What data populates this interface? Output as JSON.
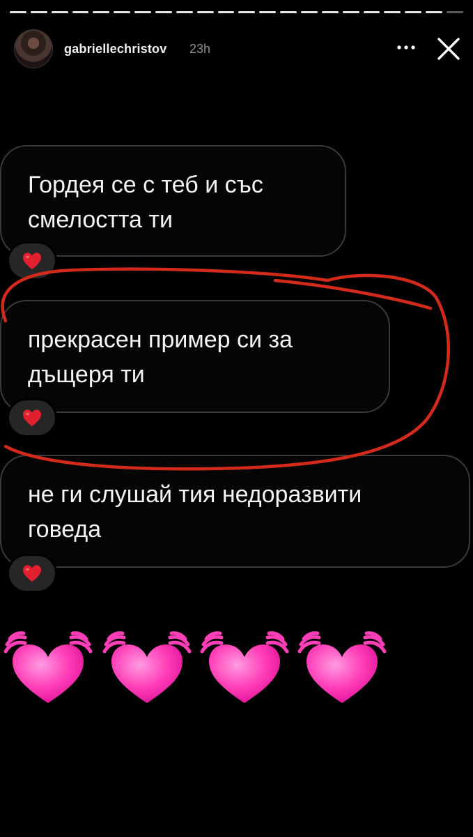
{
  "story": {
    "progress_segments": 22,
    "progress_filled_segments": 22,
    "user": {
      "username": "gabriellechristov",
      "time": "23h"
    },
    "icons": {
      "more": "more-icon",
      "close": "close-icon"
    }
  },
  "replies": [
    {
      "text": "Гордея се с теб и със\nсмелостта ти",
      "reaction": "❤️"
    },
    {
      "text": "прекрасен пример си за\nдъщеря ти",
      "reaction": "❤️"
    },
    {
      "text": "не ги слушай тия недоразвити\nговеда",
      "reaction": "❤️"
    }
  ],
  "sticker": {
    "emoji": "💓💓💓💓",
    "count": 4
  },
  "colors": {
    "accent_red": "#d42a1c",
    "heart_pink": "#ff3fb8",
    "reaction_heart": "#e0202e"
  }
}
